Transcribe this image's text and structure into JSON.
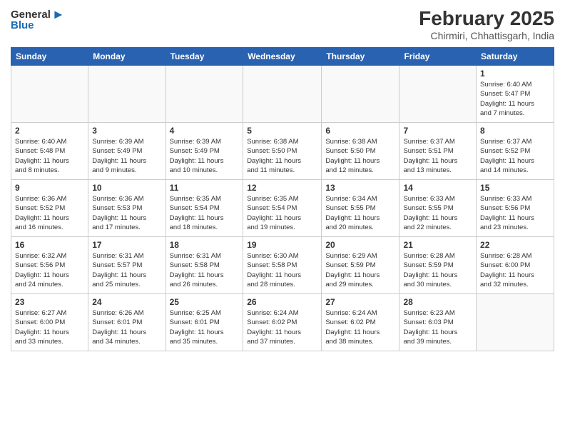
{
  "logo": {
    "general": "General",
    "blue": "Blue"
  },
  "title": "February 2025",
  "subtitle": "Chirmiri, Chhattisgarh, India",
  "weekdays": [
    "Sunday",
    "Monday",
    "Tuesday",
    "Wednesday",
    "Thursday",
    "Friday",
    "Saturday"
  ],
  "weeks": [
    [
      {
        "day": "",
        "info": ""
      },
      {
        "day": "",
        "info": ""
      },
      {
        "day": "",
        "info": ""
      },
      {
        "day": "",
        "info": ""
      },
      {
        "day": "",
        "info": ""
      },
      {
        "day": "",
        "info": ""
      },
      {
        "day": "1",
        "info": "Sunrise: 6:40 AM\nSunset: 5:47 PM\nDaylight: 11 hours\nand 7 minutes."
      }
    ],
    [
      {
        "day": "2",
        "info": "Sunrise: 6:40 AM\nSunset: 5:48 PM\nDaylight: 11 hours\nand 8 minutes."
      },
      {
        "day": "3",
        "info": "Sunrise: 6:39 AM\nSunset: 5:49 PM\nDaylight: 11 hours\nand 9 minutes."
      },
      {
        "day": "4",
        "info": "Sunrise: 6:39 AM\nSunset: 5:49 PM\nDaylight: 11 hours\nand 10 minutes."
      },
      {
        "day": "5",
        "info": "Sunrise: 6:38 AM\nSunset: 5:50 PM\nDaylight: 11 hours\nand 11 minutes."
      },
      {
        "day": "6",
        "info": "Sunrise: 6:38 AM\nSunset: 5:50 PM\nDaylight: 11 hours\nand 12 minutes."
      },
      {
        "day": "7",
        "info": "Sunrise: 6:37 AM\nSunset: 5:51 PM\nDaylight: 11 hours\nand 13 minutes."
      },
      {
        "day": "8",
        "info": "Sunrise: 6:37 AM\nSunset: 5:52 PM\nDaylight: 11 hours\nand 14 minutes."
      }
    ],
    [
      {
        "day": "9",
        "info": "Sunrise: 6:36 AM\nSunset: 5:52 PM\nDaylight: 11 hours\nand 16 minutes."
      },
      {
        "day": "10",
        "info": "Sunrise: 6:36 AM\nSunset: 5:53 PM\nDaylight: 11 hours\nand 17 minutes."
      },
      {
        "day": "11",
        "info": "Sunrise: 6:35 AM\nSunset: 5:54 PM\nDaylight: 11 hours\nand 18 minutes."
      },
      {
        "day": "12",
        "info": "Sunrise: 6:35 AM\nSunset: 5:54 PM\nDaylight: 11 hours\nand 19 minutes."
      },
      {
        "day": "13",
        "info": "Sunrise: 6:34 AM\nSunset: 5:55 PM\nDaylight: 11 hours\nand 20 minutes."
      },
      {
        "day": "14",
        "info": "Sunrise: 6:33 AM\nSunset: 5:55 PM\nDaylight: 11 hours\nand 22 minutes."
      },
      {
        "day": "15",
        "info": "Sunrise: 6:33 AM\nSunset: 5:56 PM\nDaylight: 11 hours\nand 23 minutes."
      }
    ],
    [
      {
        "day": "16",
        "info": "Sunrise: 6:32 AM\nSunset: 5:56 PM\nDaylight: 11 hours\nand 24 minutes."
      },
      {
        "day": "17",
        "info": "Sunrise: 6:31 AM\nSunset: 5:57 PM\nDaylight: 11 hours\nand 25 minutes."
      },
      {
        "day": "18",
        "info": "Sunrise: 6:31 AM\nSunset: 5:58 PM\nDaylight: 11 hours\nand 26 minutes."
      },
      {
        "day": "19",
        "info": "Sunrise: 6:30 AM\nSunset: 5:58 PM\nDaylight: 11 hours\nand 28 minutes."
      },
      {
        "day": "20",
        "info": "Sunrise: 6:29 AM\nSunset: 5:59 PM\nDaylight: 11 hours\nand 29 minutes."
      },
      {
        "day": "21",
        "info": "Sunrise: 6:28 AM\nSunset: 5:59 PM\nDaylight: 11 hours\nand 30 minutes."
      },
      {
        "day": "22",
        "info": "Sunrise: 6:28 AM\nSunset: 6:00 PM\nDaylight: 11 hours\nand 32 minutes."
      }
    ],
    [
      {
        "day": "23",
        "info": "Sunrise: 6:27 AM\nSunset: 6:00 PM\nDaylight: 11 hours\nand 33 minutes."
      },
      {
        "day": "24",
        "info": "Sunrise: 6:26 AM\nSunset: 6:01 PM\nDaylight: 11 hours\nand 34 minutes."
      },
      {
        "day": "25",
        "info": "Sunrise: 6:25 AM\nSunset: 6:01 PM\nDaylight: 11 hours\nand 35 minutes."
      },
      {
        "day": "26",
        "info": "Sunrise: 6:24 AM\nSunset: 6:02 PM\nDaylight: 11 hours\nand 37 minutes."
      },
      {
        "day": "27",
        "info": "Sunrise: 6:24 AM\nSunset: 6:02 PM\nDaylight: 11 hours\nand 38 minutes."
      },
      {
        "day": "28",
        "info": "Sunrise: 6:23 AM\nSunset: 6:03 PM\nDaylight: 11 hours\nand 39 minutes."
      },
      {
        "day": "",
        "info": ""
      }
    ]
  ]
}
